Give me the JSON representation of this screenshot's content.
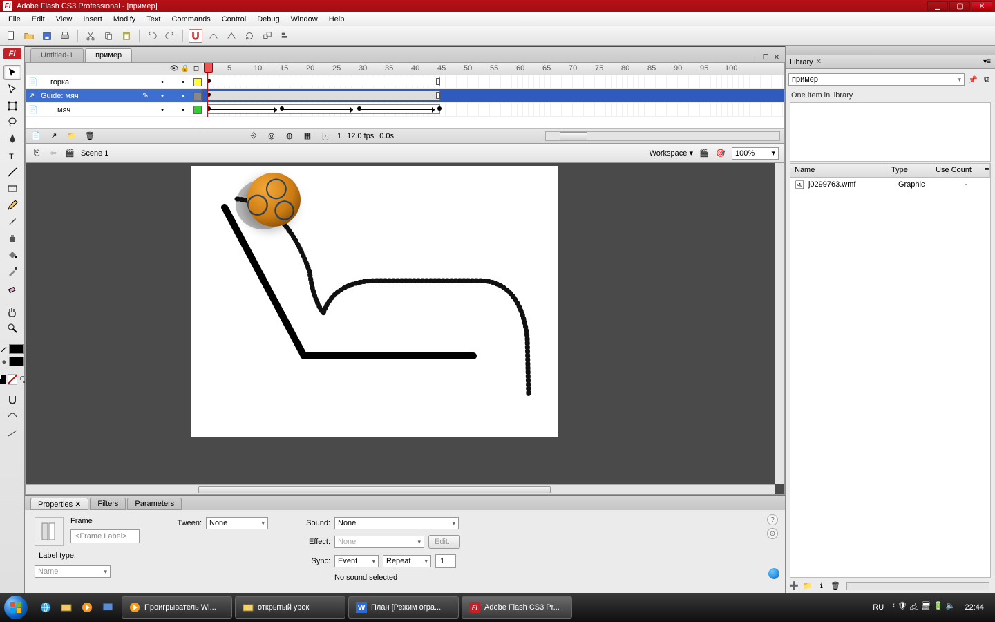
{
  "title": "Adobe Flash CS3 Professional - [пример]",
  "menu": [
    "File",
    "Edit",
    "View",
    "Insert",
    "Modify",
    "Text",
    "Commands",
    "Control",
    "Debug",
    "Window",
    "Help"
  ],
  "docTabs": [
    {
      "label": "Untitled-1",
      "active": false
    },
    {
      "label": "пример",
      "active": true
    }
  ],
  "timeline": {
    "ruler": [
      1,
      5,
      10,
      15,
      20,
      25,
      30,
      35,
      40,
      45,
      50,
      55,
      60,
      65,
      70,
      75,
      80,
      85,
      90,
      95,
      100
    ],
    "layers": [
      {
        "name": "горка",
        "swatch": "#ffff33",
        "selected": false,
        "indent": false
      },
      {
        "name": "Guide: мяч",
        "swatch": "#888888",
        "selected": true,
        "indent": false,
        "editing": true
      },
      {
        "name": "мяч",
        "swatch": "#33cc33",
        "selected": false,
        "indent": true
      }
    ],
    "status": {
      "frame": "1",
      "fps": "12.0 fps",
      "time": "0.0s"
    }
  },
  "scenebar": {
    "scene": "Scene 1",
    "workspace_label": "Workspace",
    "zoom": "100%"
  },
  "properties": {
    "tabs": [
      "Properties",
      "Filters",
      "Parameters"
    ],
    "object_type": "Frame",
    "frame_label_placeholder": "<Frame Label>",
    "tween_label": "Tween:",
    "tween_value": "None",
    "sound_label": "Sound:",
    "sound_value": "None",
    "effect_label": "Effect:",
    "effect_value": "None",
    "edit_btn": "Edit...",
    "sync_label": "Sync:",
    "sync_value": "Event",
    "repeat_value": "Repeat",
    "repeat_count": "1",
    "label_type_label": "Label type:",
    "label_type_value": "Name",
    "no_sound": "No sound selected"
  },
  "library": {
    "panel_title": "Library",
    "doc": "пример",
    "count": "One item in library",
    "columns": [
      "Name",
      "Type",
      "Use Count"
    ],
    "items": [
      {
        "name": "j0299763.wmf",
        "type": "Graphic",
        "use": "-"
      }
    ]
  },
  "taskbar": {
    "items": [
      {
        "label": "Проигрыватель Wi...",
        "color": "#f59b1a",
        "active": false
      },
      {
        "label": "открытый урок",
        "color": "#f5d36b",
        "active": false
      },
      {
        "label": "План [Режим огра...",
        "color": "#2b6bd6",
        "active": false
      },
      {
        "label": "Adobe Flash CS3 Pr...",
        "color": "#c32027",
        "active": true
      }
    ],
    "lang": "RU",
    "time": "22:44"
  }
}
